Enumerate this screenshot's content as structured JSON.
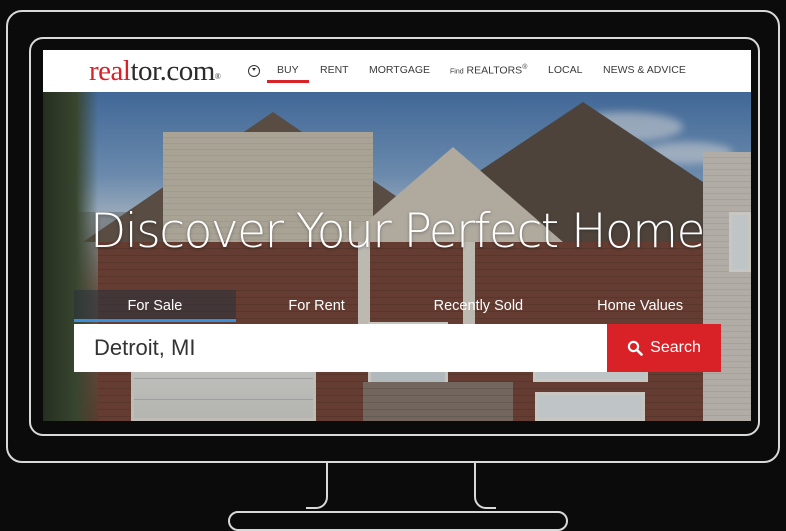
{
  "logo": {
    "red_text": "real",
    "dark_text": "tor.com",
    "mark": "®"
  },
  "nav": {
    "items": [
      {
        "label": "BUY"
      },
      {
        "label": "RENT"
      },
      {
        "label": "MORTGAGE"
      },
      {
        "small": "Find",
        "label": "REALTORS",
        "mark": "®"
      },
      {
        "label": "LOCAL"
      },
      {
        "label": "NEWS & ADVICE"
      }
    ],
    "icon": "chevron-circle-down-icon"
  },
  "hero": {
    "headline": "Discover Your Perfect Home",
    "tabs": [
      "For Sale",
      "For Rent",
      "Recently Sold",
      "Home Values"
    ],
    "search": {
      "value": "Detroit, MI",
      "button_label": "Search",
      "icon": "search-icon"
    }
  },
  "colors": {
    "brand_red": "#d92228",
    "active_tab_underline": "#3a8fd8",
    "background": "#0b0b0b",
    "outline": "#d9d9d9"
  }
}
